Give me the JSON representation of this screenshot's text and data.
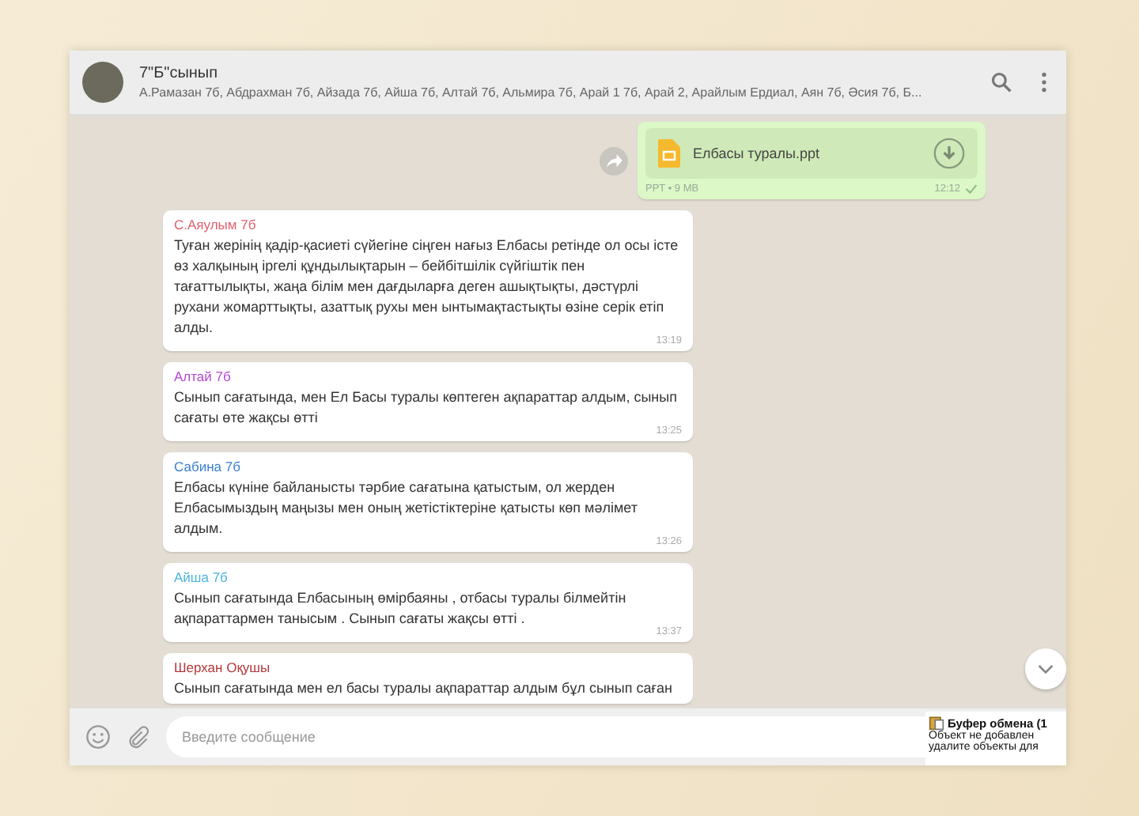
{
  "chat": {
    "title": "7\"Б\"сынып",
    "members": "А.Рамазан 7б, Абдрахман 7б, Айзада 7б, Айша 7б, Алтай 7б, Альмира 7б, Арай 1 7б, Арай 2, Арайлым Ердиал, Аян 7б, Әсия 7б, Б...",
    "messages": [
      {
        "kind": "file",
        "file_name": "Елбасы туралы.ppt",
        "meta": "PPT • 9 MB",
        "time": "12:12",
        "delivered": true
      },
      {
        "kind": "text",
        "author": "С.Аяулым 7б",
        "color": "#e0606e",
        "text": "Туған жерінің қадір-қасиеті сүйегіне сіңген нағыз Елбасы ретінде ол осы істе өз халқының іргелі құндылықтарын – бейбітшілік сүйгіштік пен тағаттылықты, жаңа білім мен дағдыларға деген ашықтықты, дәстүрлі рухани жомарттықты, азаттық рухы мен ынтымақтастықты өзіне серік етіп алды.",
        "time": "13:19"
      },
      {
        "kind": "text",
        "author": "Алтай 7б",
        "color": "#b548d4",
        "text": "Сынып сағатында, мен Ел Басы туралы көптеген ақпараттар алдым, сынып сағаты өте жақсы өтті",
        "time": "13:25"
      },
      {
        "kind": "text",
        "author": "Сабина 7б",
        "color": "#3b7fd4",
        "text": "Елбасы күніне байланысты тәрбие сағатына қатыстым, ол жерден Елбасымыздың маңызы мен оның жетістіктеріне қатысты көп мәлімет алдым.",
        "time": "13:26"
      },
      {
        "kind": "text",
        "author": "Айша 7б",
        "color": "#4cb6dc",
        "text": "Сынып сағатында Елбасының өмірбаяны , отбасы туралы білмейтін ақпараттармен танысым .  Сынып сағаты жақсы өтті .",
        "time": "13:37"
      },
      {
        "kind": "text",
        "author": "Шерхан Оқушы",
        "color": "#b5393c",
        "text": "Сынып сағатында мен ел басы туралы ақпараттар алдым бұл сынып саған"
      }
    ]
  },
  "composer": {
    "placeholder": "Введите сообщение"
  },
  "clipboard_popup": {
    "title": "Буфер обмена (1",
    "lines": [
      "Объект не добавлен",
      "удалите объекты для"
    ]
  }
}
